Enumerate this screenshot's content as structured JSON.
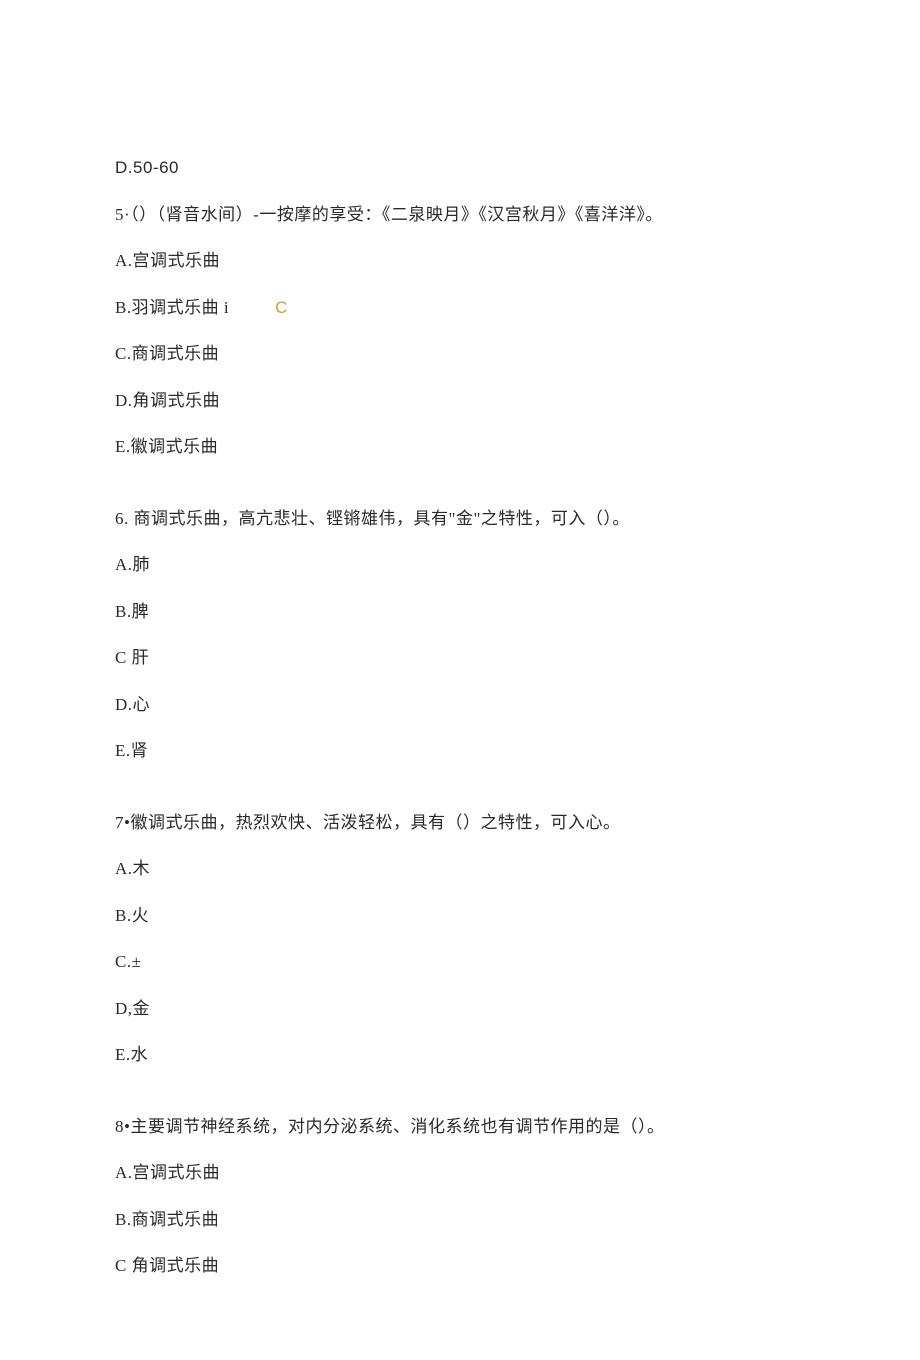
{
  "lines": {
    "l1": "D.50-60",
    "l2a": "5·（）（肾音水间）-一按摩的享受：《二泉映月》《汉宫秋月》《喜洋洋》。",
    "l3": "A.宫调式乐曲",
    "l4a": "B.羽调式乐曲 i",
    "l4b": "C",
    "l5": "C.商调式乐曲",
    "l6": "D.角调式乐曲",
    "l7": "E.徽调式乐曲",
    "l8": "6. 商调式乐曲，高亢悲壮、铿锵雄伟，具有\"金\"之特性，可入（）。",
    "l9": "A.肺",
    "l10": "B.脾",
    "l11": "C 肝",
    "l12": "D.心",
    "l13": "E.肾",
    "l14": "7•徽调式乐曲，热烈欢快、活泼轻松，具有（）之特性，可入心。",
    "l15": "A.木",
    "l16": "B.火",
    "l17": "C.±",
    "l18": "D,金",
    "l19": "E.水",
    "l20": "8•主要调节神经系统，对内分泌系统、消化系统也有调节作用的是（）。",
    "l21": "A.宫调式乐曲",
    "l22": "B.商调式乐曲",
    "l23": "C 角调式乐曲"
  }
}
